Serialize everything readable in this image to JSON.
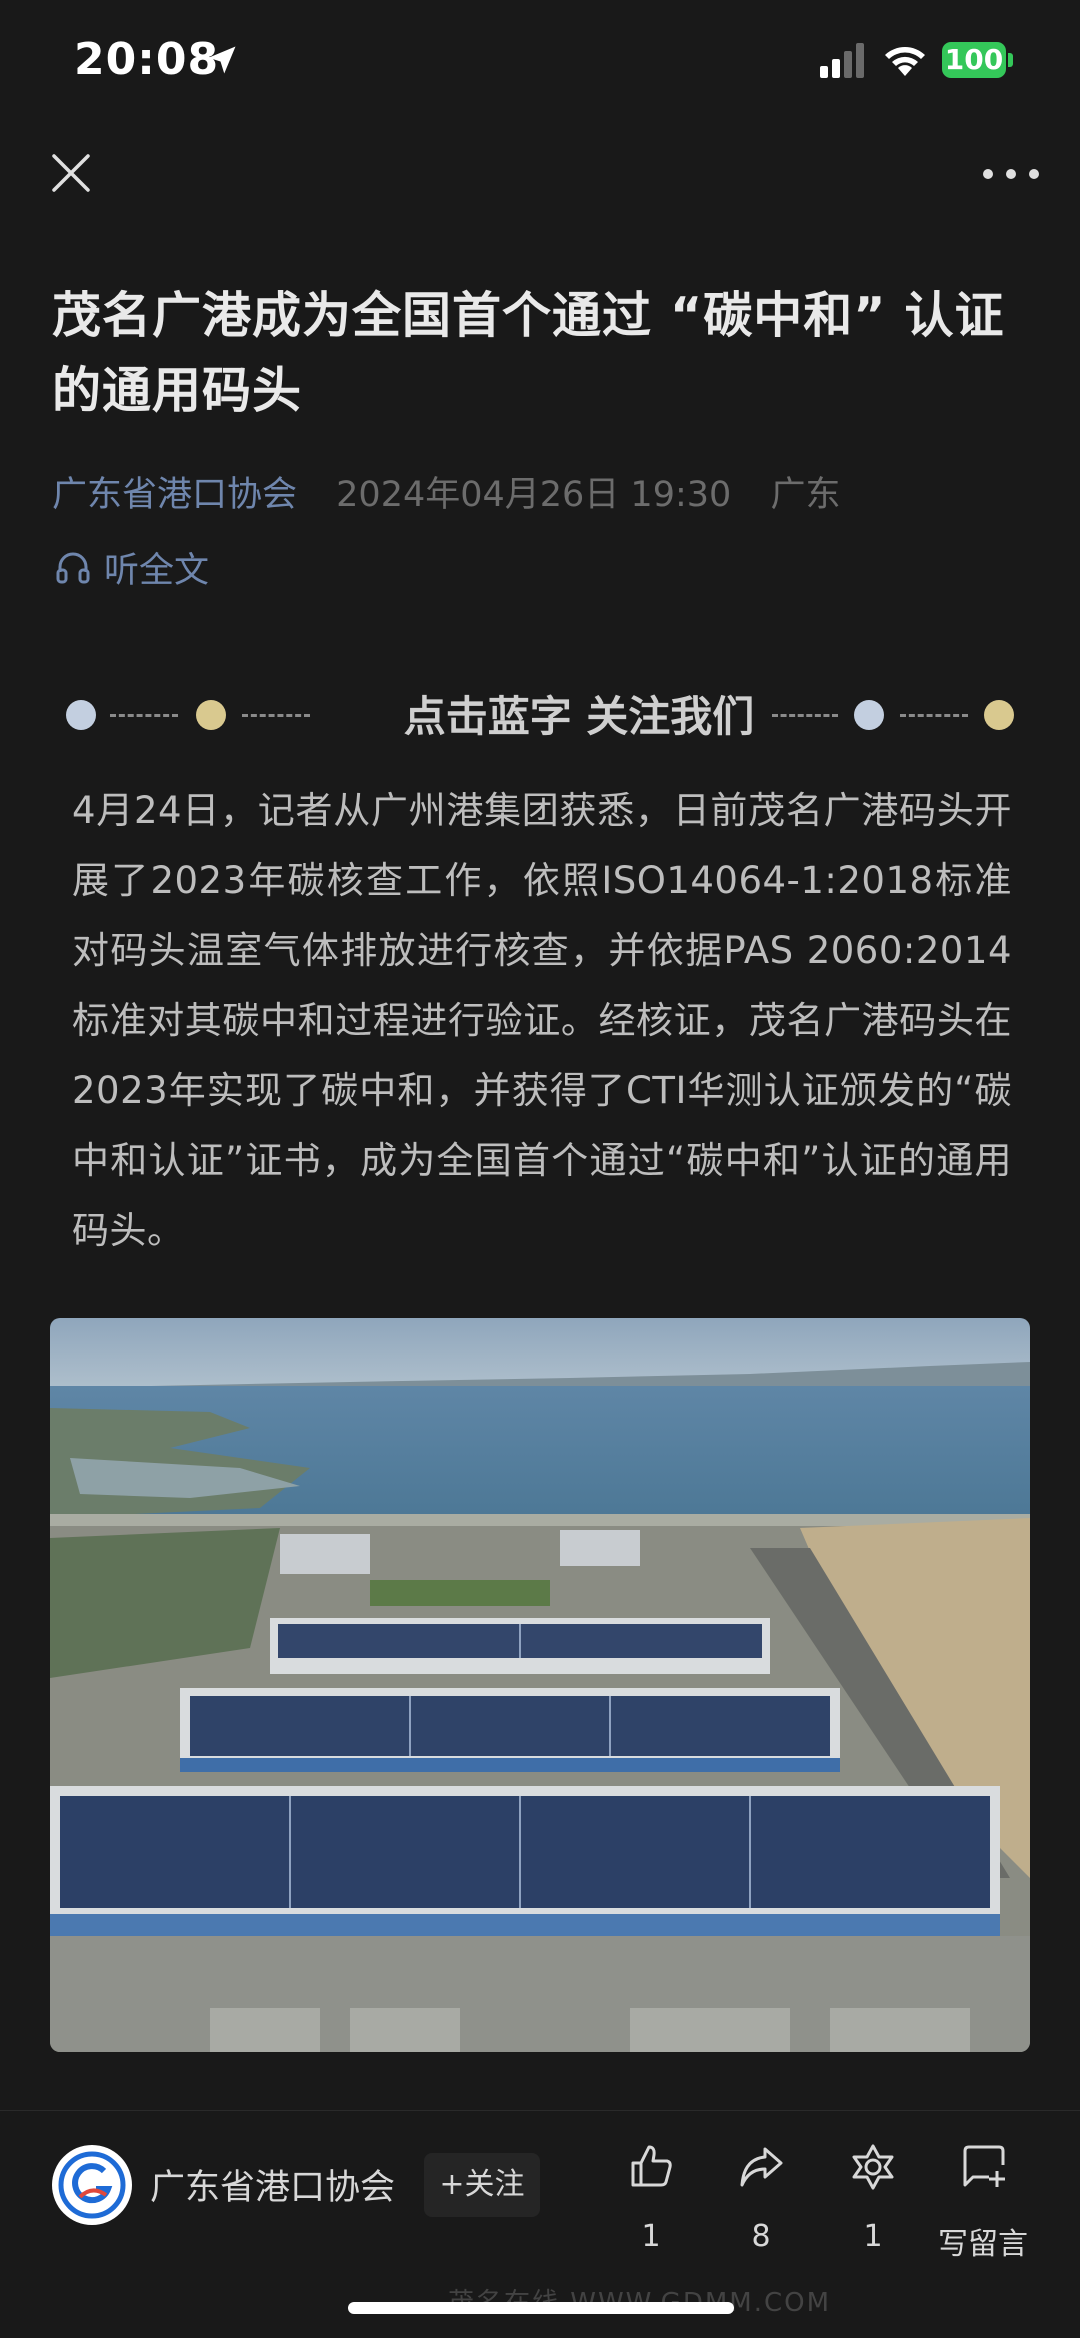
{
  "status_bar": {
    "time": "20:08",
    "battery": "100"
  },
  "article": {
    "title": "茂名广港成为全国首个通过 “碳中和” 认证的通用码头",
    "account": "广东省港口协会",
    "date": "2024年04月26日 19:30",
    "region": "广东",
    "listen_label": "听全文"
  },
  "banner": {
    "text": "点击蓝字 关注我们",
    "colors": {
      "blue_dot": "#c3cfe0",
      "gold_dot": "#d9c98f"
    }
  },
  "body_paragraph": "4月24日，记者从广州港集团获悉，日前茂名广港码头开展了2023年碳核查工作，依照ISO14064-1:2018标准对码头温室气体排放进行核查，并依据PAS 2060:2014标准对其碳中和过程进行验证。经核证，茂名广港码头在2023年实现了碳中和，并获得了CTI华测认证颁发的“碳中和认证”证书，成为全国首个通过“碳中和”认证的通用码头。",
  "bottom_bar": {
    "account_name": "广东省港口协会",
    "follow_label": "+关注",
    "likes": "1",
    "shares": "8",
    "favorites": "1",
    "comment_label": "写留言"
  },
  "watermark": "茂名在线 WWW.GDMM.COM",
  "accent_color": "#6f86ad"
}
